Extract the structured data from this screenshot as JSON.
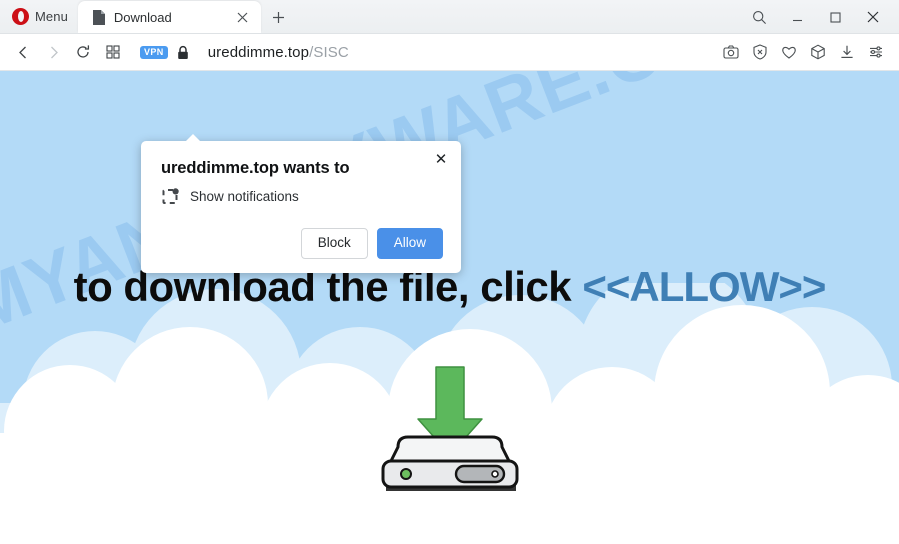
{
  "window": {
    "menu_label": "Menu",
    "controls": [
      {
        "name": "search-button",
        "glyph": "search"
      },
      {
        "name": "minimize-button",
        "glyph": "minimize"
      },
      {
        "name": "maximize-button",
        "glyph": "maximize"
      },
      {
        "name": "close-button",
        "glyph": "close"
      }
    ]
  },
  "tabs": [
    {
      "title": "Download",
      "favicon": "page-icon",
      "close_label": "✕"
    }
  ],
  "newtab_label": "+",
  "navigation": {
    "back": "back-arrow-icon",
    "forward": "forward-arrow-icon",
    "reload": "reload-icon",
    "tab_overview": "grid-icon"
  },
  "address_bar": {
    "vpn_badge": "VPN",
    "security_icon": "lock-icon",
    "url_host": "ureddimme.top",
    "url_path": "/SISC"
  },
  "toolbar_icons": [
    {
      "name": "snapshot-icon",
      "label": "camera"
    },
    {
      "name": "ad-blocker-icon",
      "label": "shield-x"
    },
    {
      "name": "favorites-icon",
      "label": "heart"
    },
    {
      "name": "extensions-icon",
      "label": "cube"
    },
    {
      "name": "downloads-icon",
      "label": "download-arrow"
    },
    {
      "name": "easy-setup-icon",
      "label": "sliders"
    }
  ],
  "permission_dialog": {
    "title": "ureddimme.top wants to",
    "permission_icon": "notifications-icon",
    "permission_label": "Show notifications",
    "block_label": "Block",
    "allow_label": "Allow",
    "close_label": "✕",
    "allow_color": "#4a90e8"
  },
  "page": {
    "headline_prefix": "to download the file, click ",
    "headline_allow": "<<ALLOW>>",
    "watermark": "MYANTISPYWARE.COM",
    "background_color": "#b3daf7",
    "arrow_color": "#5cb85c",
    "illustration": "hard-drive-download-icon"
  }
}
